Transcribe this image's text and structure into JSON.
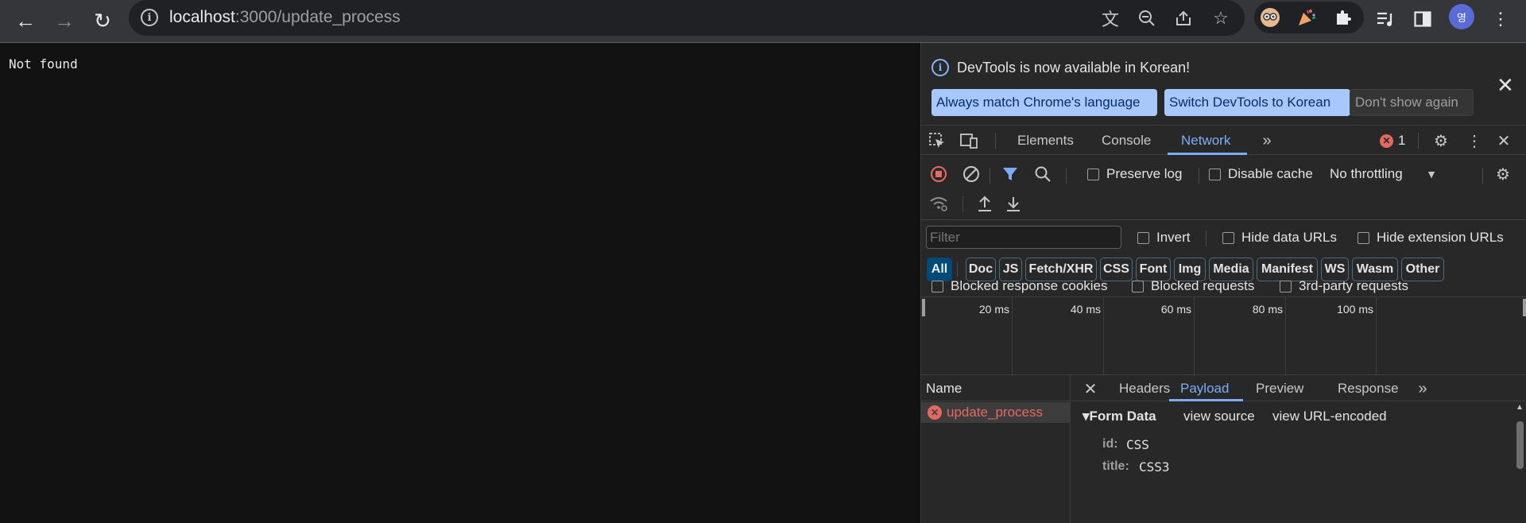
{
  "browser": {
    "url_host": "localhost",
    "url_path": ":3000/update_process",
    "avatar_letter": "영"
  },
  "page": {
    "message": "Not found"
  },
  "devtools": {
    "infobar": {
      "message": "DevTools is now available in Korean!",
      "btn_match": "Always match Chrome's language",
      "btn_switch": "Switch DevTools to Korean",
      "btn_dont_show": "Don't show again"
    },
    "tabs": {
      "elements": "Elements",
      "console": "Console",
      "network": "Network",
      "error_count": "1"
    },
    "toolbar": {
      "preserve_log": "Preserve log",
      "disable_cache": "Disable cache",
      "throttling": "No throttling"
    },
    "filter": {
      "placeholder": "Filter",
      "invert": "Invert",
      "hide_data_urls": "Hide data URLs",
      "hide_ext_urls": "Hide extension URLs"
    },
    "types": [
      "All",
      "Doc",
      "JS",
      "Fetch/XHR",
      "CSS",
      "Font",
      "Img",
      "Media",
      "Manifest",
      "WS",
      "Wasm",
      "Other"
    ],
    "blocked": {
      "blocked_cookies": "Blocked response cookies",
      "blocked_requests": "Blocked requests",
      "third_party": "3rd-party requests"
    },
    "timeline_labels": [
      "20 ms",
      "40 ms",
      "60 ms",
      "80 ms",
      "100 ms"
    ],
    "requests": {
      "header": "Name",
      "items": [
        "update_process"
      ]
    },
    "detail": {
      "tabs": [
        "Headers",
        "Payload",
        "Preview",
        "Response"
      ],
      "form_data": "▾Form Data",
      "view_source": "view source",
      "view_url_encoded": "view URL-encoded",
      "fields": [
        {
          "key": "id:",
          "value": "CSS"
        },
        {
          "key": "title:",
          "value": "CSS3"
        }
      ]
    }
  }
}
